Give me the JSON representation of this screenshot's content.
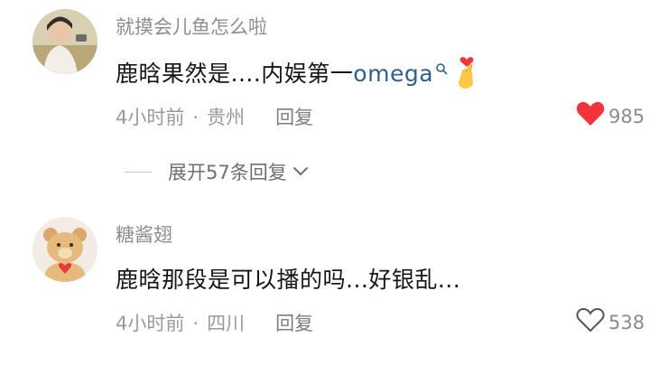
{
  "comments": [
    {
      "username": "就摸会儿鱼怎么啦",
      "text": "鹿晗果然是....内娱第一",
      "link": "omega",
      "time": "4小时前",
      "location": "贵州",
      "reply_label": "回复",
      "likes": "985",
      "liked": true,
      "expand": "展开57条回复"
    },
    {
      "username": "糖酱翅",
      "text": "鹿晗那段是可以播的吗...好银乱...",
      "time": "4小时前",
      "location": "四川",
      "reply_label": "回复",
      "likes": "538",
      "liked": false
    }
  ],
  "colors": {
    "like_active": "#f0353d",
    "link": "#2f5f8f"
  },
  "icons": [
    "search-icon",
    "finger-heart-emoji",
    "heart-icon",
    "chevron-down-icon"
  ]
}
